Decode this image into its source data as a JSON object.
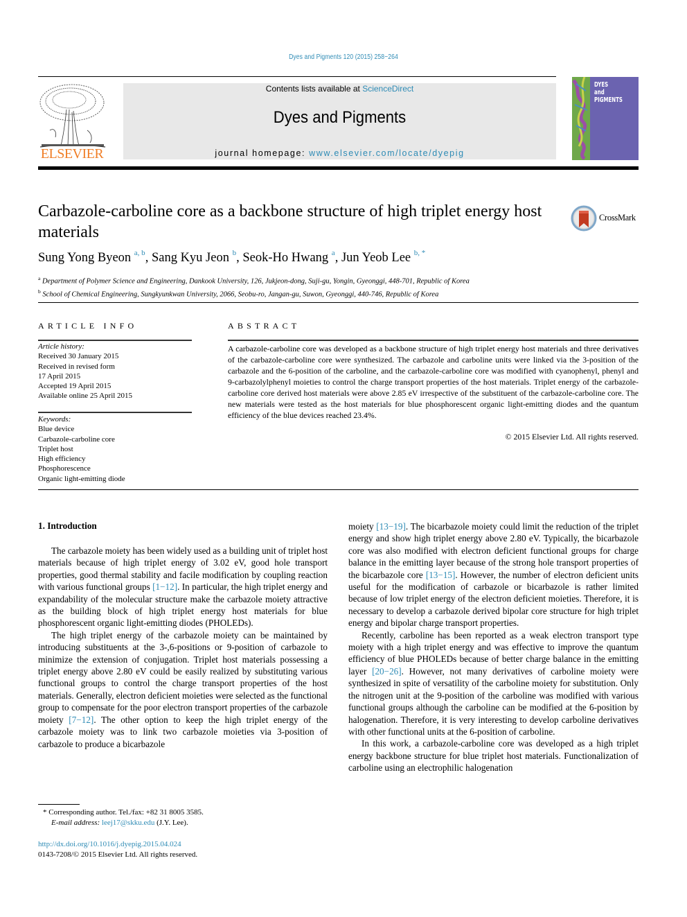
{
  "header": {
    "citation": "Dyes and Pigments 120 (2015) 258−264",
    "contents_prefix": "Contents lists available at ",
    "contents_link": "ScienceDirect",
    "journal_title": "Dyes and Pigments",
    "homepage_prefix": "journal homepage: ",
    "homepage_link": "www.elsevier.com/locate/dyepig",
    "publisher_logo_text": "ELSEVIER",
    "cover_text": [
      "DYES",
      "and",
      "PIGMENTS"
    ],
    "colors": {
      "link": "#2e8bb5",
      "elsevier_orange": "#f07e26",
      "cover_purple": "#6b63b0"
    }
  },
  "article": {
    "title": "Carbazole-carboline core as a backbone structure of high triplet energy host materials",
    "crossmark_label": "CrossMark",
    "authors": [
      {
        "name": "Sung Yong Byeon",
        "sup": "a, b"
      },
      {
        "name": "Sang Kyu Jeon",
        "sup": "b"
      },
      {
        "name": "Seok-Ho Hwang",
        "sup": "a"
      },
      {
        "name": "Jun Yeob Lee",
        "sup": "b, *"
      }
    ],
    "affiliations": [
      {
        "mark": "a",
        "text": "Department of Polymer Science and Engineering, Dankook University, 126, Jukjeon-dong, Suji-gu, Yongin, Gyeonggi, 448-701, Republic of Korea"
      },
      {
        "mark": "b",
        "text": "School of Chemical Engineering, Sungkyunkwan University, 2066, Seobu-ro, Jangan-gu, Suwon, Gyeonggi, 440-746, Republic of Korea"
      }
    ]
  },
  "article_info": {
    "heading": "ARTICLE INFO",
    "history_label": "Article history:",
    "history": [
      "Received 30 January 2015",
      "Received in revised form",
      "17 April 2015",
      "Accepted 19 April 2015",
      "Available online 25 April 2015"
    ],
    "keywords_label": "Keywords:",
    "keywords": [
      "Blue device",
      "Carbazole-carboline core",
      "Triplet host",
      "High efficiency",
      "Phosphorescence",
      "Organic light-emitting diode"
    ]
  },
  "abstract": {
    "heading": "ABSTRACT",
    "text": "A carbazole-carboline core was developed as a backbone structure of high triplet energy host materials and three derivatives of the carbazole-carboline core were synthesized. The carbazole and carboline units were linked via the 3-position of the carbazole and the 6-position of the carboline, and the carbazole-carboline core was modified with cyanophenyl, phenyl and 9-carbazolylphenyl moieties to control the charge transport properties of the host materials. Triplet energy of the carbazole-carboline core derived host materials were above 2.85 eV irrespective of the substituent of the carbazole-carboline core. The new materials were tested as the host materials for blue phosphorescent organic light-emitting diodes and the quantum efficiency of the blue devices reached 23.4%.",
    "copyright": "© 2015 Elsevier Ltd. All rights reserved."
  },
  "body": {
    "intro_heading": "1.  Introduction",
    "left": {
      "p1_a": "The carbazole moiety has been widely used as a building unit of triplet host materials because of high triplet energy of 3.02 eV, good hole transport properties, good thermal stability and facile modification by coupling reaction with various functional groups ",
      "p1_ref": "[1−12]",
      "p1_b": ". In particular, the high triplet energy and expandability of the molecular structure make the carbazole moiety attractive as the building block of high triplet energy host materials for blue phosphorescent organic light-emitting diodes (PHOLEDs).",
      "p2_a": "The high triplet energy of the carbazole moiety can be maintained by introducing substituents at the 3-,6-positions or 9-position of carbazole to minimize the extension of conjugation. Triplet host materials possessing a triplet energy above 2.80 eV could be easily realized by substituting various functional groups to control the charge transport properties of the host materials. Generally, electron deficient moieties were selected as the functional group to compensate for the poor electron transport properties of the carbazole moiety ",
      "p2_ref": "[7−12]",
      "p2_b": ". The other option to keep the high triplet energy of the carbazole moiety was to link two carbazole moieties via 3-position of carbazole to produce a bicarbazole"
    },
    "right": {
      "p1_a": "moiety ",
      "p1_ref1": "[13−19]",
      "p1_b": ". The bicarbazole moiety could limit the reduction of the triplet energy and show high triplet energy above 2.80 eV. Typically, the bicarbazole core was also modified with electron deficient functional groups for charge balance in the emitting layer because of the strong hole transport properties of the bicarbazole core ",
      "p1_ref2": "[13−15]",
      "p1_c": ". However, the number of electron deficient units useful for the modification of carbazole or bicarbazole is rather limited because of low triplet energy of the electron deficient moieties. Therefore, it is necessary to develop a carbazole derived bipolar core structure for high triplet energy and bipolar charge transport properties.",
      "p2_a": "Recently, carboline has been reported as a weak electron transport type moiety with a high triplet energy and was effective to improve the quantum efficiency of blue PHOLEDs because of better charge balance in the emitting layer ",
      "p2_ref": "[20−26]",
      "p2_b": ". However, not many derivatives of carboline moiety were synthesized in spite of versatility of the carboline moiety for substitution. Only the nitrogen unit at the 9-position of the carboline was modified with various functional groups although the carboline can be modified at the 6-position by halogenation. Therefore, it is very interesting to develop carboline derivatives with other functional units at the 6-position of carboline.",
      "p3": "In this work, a carbazole-carboline core was developed as a high triplet energy backbone structure for blue triplet host materials. Functionalization of carboline using an electrophilic halogenation"
    }
  },
  "footer": {
    "corresponding": "* Corresponding author. Tel./fax: +82 31 8005 3585.",
    "email_label": "E-mail address: ",
    "email": "leej17@skku.edu",
    "email_suffix": " (J.Y. Lee).",
    "doi": "http://dx.doi.org/10.1016/j.dyepig.2015.04.024",
    "issn_line": "0143-7208/© 2015 Elsevier Ltd. All rights reserved."
  }
}
